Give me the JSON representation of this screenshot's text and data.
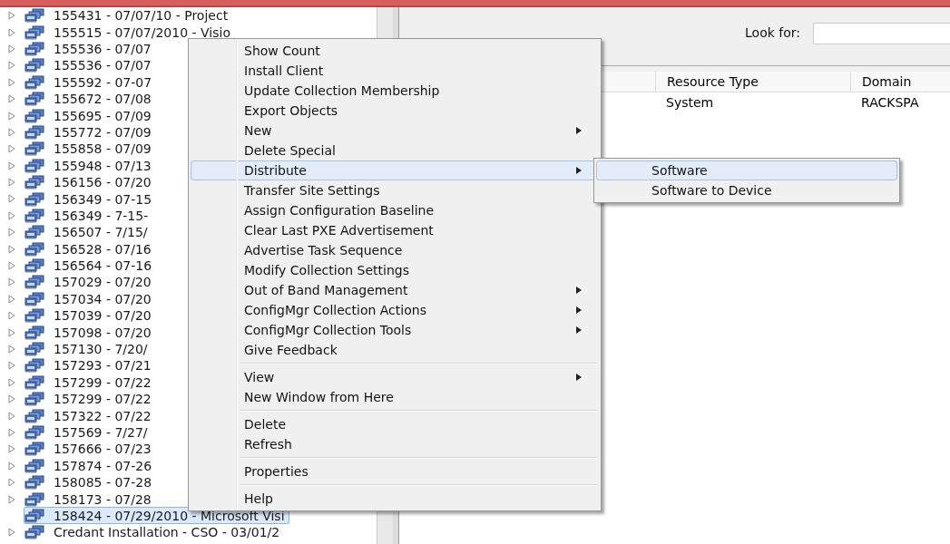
{
  "tree": {
    "items": [
      {
        "label": "155431 - 07/07/10 - Project",
        "expandable": true,
        "selected": false
      },
      {
        "label": "155515 - 07/07/2010 - Visio",
        "expandable": true,
        "selected": false
      },
      {
        "label": "155536 - 07/07",
        "expandable": true,
        "selected": false
      },
      {
        "label": "155536 - 07/07",
        "expandable": true,
        "selected": false
      },
      {
        "label": "155592 - 07-07",
        "expandable": true,
        "selected": false
      },
      {
        "label": "155672 - 07/08",
        "expandable": true,
        "selected": false
      },
      {
        "label": "155695 - 07/09",
        "expandable": true,
        "selected": false
      },
      {
        "label": "155772 - 07/09",
        "expandable": true,
        "selected": false
      },
      {
        "label": "155858 - 07/09",
        "expandable": true,
        "selected": false
      },
      {
        "label": "155948 - 07/13",
        "expandable": true,
        "selected": false
      },
      {
        "label": "156156 - 07/20",
        "expandable": true,
        "selected": false
      },
      {
        "label": "156349 - 07-15",
        "expandable": true,
        "selected": false
      },
      {
        "label": "156349 - 7-15-",
        "expandable": true,
        "selected": false
      },
      {
        "label": "156507 - 7/15/",
        "expandable": true,
        "selected": false
      },
      {
        "label": "156528 - 07/16",
        "expandable": true,
        "selected": false
      },
      {
        "label": "156564 - 07-16",
        "expandable": true,
        "selected": false
      },
      {
        "label": "157029 - 07/20",
        "expandable": true,
        "selected": false
      },
      {
        "label": "157034 - 07/20",
        "expandable": true,
        "selected": false
      },
      {
        "label": "157039 - 07/20",
        "expandable": true,
        "selected": false
      },
      {
        "label": "157098 - 07/20",
        "expandable": true,
        "selected": false
      },
      {
        "label": "157130 - 7/20/",
        "expandable": true,
        "selected": false
      },
      {
        "label": "157293 - 07/21",
        "expandable": true,
        "selected": false
      },
      {
        "label": "157299 - 07/22",
        "expandable": true,
        "selected": false
      },
      {
        "label": "157299 - 07/22",
        "expandable": true,
        "selected": false
      },
      {
        "label": "157322 - 07/22",
        "expandable": true,
        "selected": false
      },
      {
        "label": "157569 - 7/27/",
        "expandable": true,
        "selected": false
      },
      {
        "label": "157666 - 07/23",
        "expandable": true,
        "selected": false
      },
      {
        "label": "157874 - 07-26",
        "expandable": true,
        "selected": false
      },
      {
        "label": "158085 - 07-28",
        "expandable": true,
        "selected": false
      },
      {
        "label": "158173 - 07/28",
        "expandable": true,
        "selected": false
      },
      {
        "label": "158424 - 07/29/2010 - Microsoft Visi",
        "expandable": false,
        "selected": true
      },
      {
        "label": "Credant Installation - CSO - 03/01/2",
        "expandable": true,
        "selected": false
      }
    ]
  },
  "search": {
    "label": "Look for:"
  },
  "table": {
    "columns": [
      "Resource Type",
      "Domain"
    ],
    "rows": [
      [
        "System",
        "RACKSPA"
      ]
    ]
  },
  "context_menu": {
    "items": [
      {
        "kind": "item",
        "label": "Show Count",
        "submenu": false,
        "selected": false
      },
      {
        "kind": "item",
        "label": "Install Client",
        "submenu": false,
        "selected": false
      },
      {
        "kind": "item",
        "label": "Update Collection Membership",
        "submenu": false,
        "selected": false
      },
      {
        "kind": "item",
        "label": "Export Objects",
        "submenu": false,
        "selected": false
      },
      {
        "kind": "item",
        "label": "New",
        "submenu": true,
        "selected": false
      },
      {
        "kind": "item",
        "label": "Delete Special",
        "submenu": false,
        "selected": false
      },
      {
        "kind": "item",
        "label": "Distribute",
        "submenu": true,
        "selected": true
      },
      {
        "kind": "item",
        "label": "Transfer Site Settings",
        "submenu": false,
        "selected": false
      },
      {
        "kind": "item",
        "label": "Assign Configuration Baseline",
        "submenu": false,
        "selected": false
      },
      {
        "kind": "item",
        "label": "Clear Last PXE Advertisement",
        "submenu": false,
        "selected": false
      },
      {
        "kind": "item",
        "label": "Advertise Task Sequence",
        "submenu": false,
        "selected": false
      },
      {
        "kind": "item",
        "label": "Modify Collection Settings",
        "submenu": false,
        "selected": false
      },
      {
        "kind": "item",
        "label": "Out of Band Management",
        "submenu": true,
        "selected": false
      },
      {
        "kind": "item",
        "label": "ConfigMgr Collection Actions",
        "submenu": true,
        "selected": false
      },
      {
        "kind": "item",
        "label": "ConfigMgr Collection Tools",
        "submenu": true,
        "selected": false
      },
      {
        "kind": "item",
        "label": "Give Feedback",
        "submenu": false,
        "selected": false
      },
      {
        "kind": "separator"
      },
      {
        "kind": "item",
        "label": "View",
        "submenu": true,
        "selected": false
      },
      {
        "kind": "item",
        "label": "New Window from Here",
        "submenu": false,
        "selected": false
      },
      {
        "kind": "separator"
      },
      {
        "kind": "item",
        "label": "Delete",
        "submenu": false,
        "selected": false
      },
      {
        "kind": "item",
        "label": "Refresh",
        "submenu": false,
        "selected": false
      },
      {
        "kind": "separator"
      },
      {
        "kind": "item",
        "label": "Properties",
        "submenu": false,
        "selected": false
      },
      {
        "kind": "separator"
      },
      {
        "kind": "item",
        "label": "Help",
        "submenu": false,
        "selected": false
      }
    ]
  },
  "submenu": {
    "items": [
      {
        "label": "Software",
        "selected": true
      },
      {
        "label": "Software to Device",
        "selected": false
      }
    ]
  }
}
